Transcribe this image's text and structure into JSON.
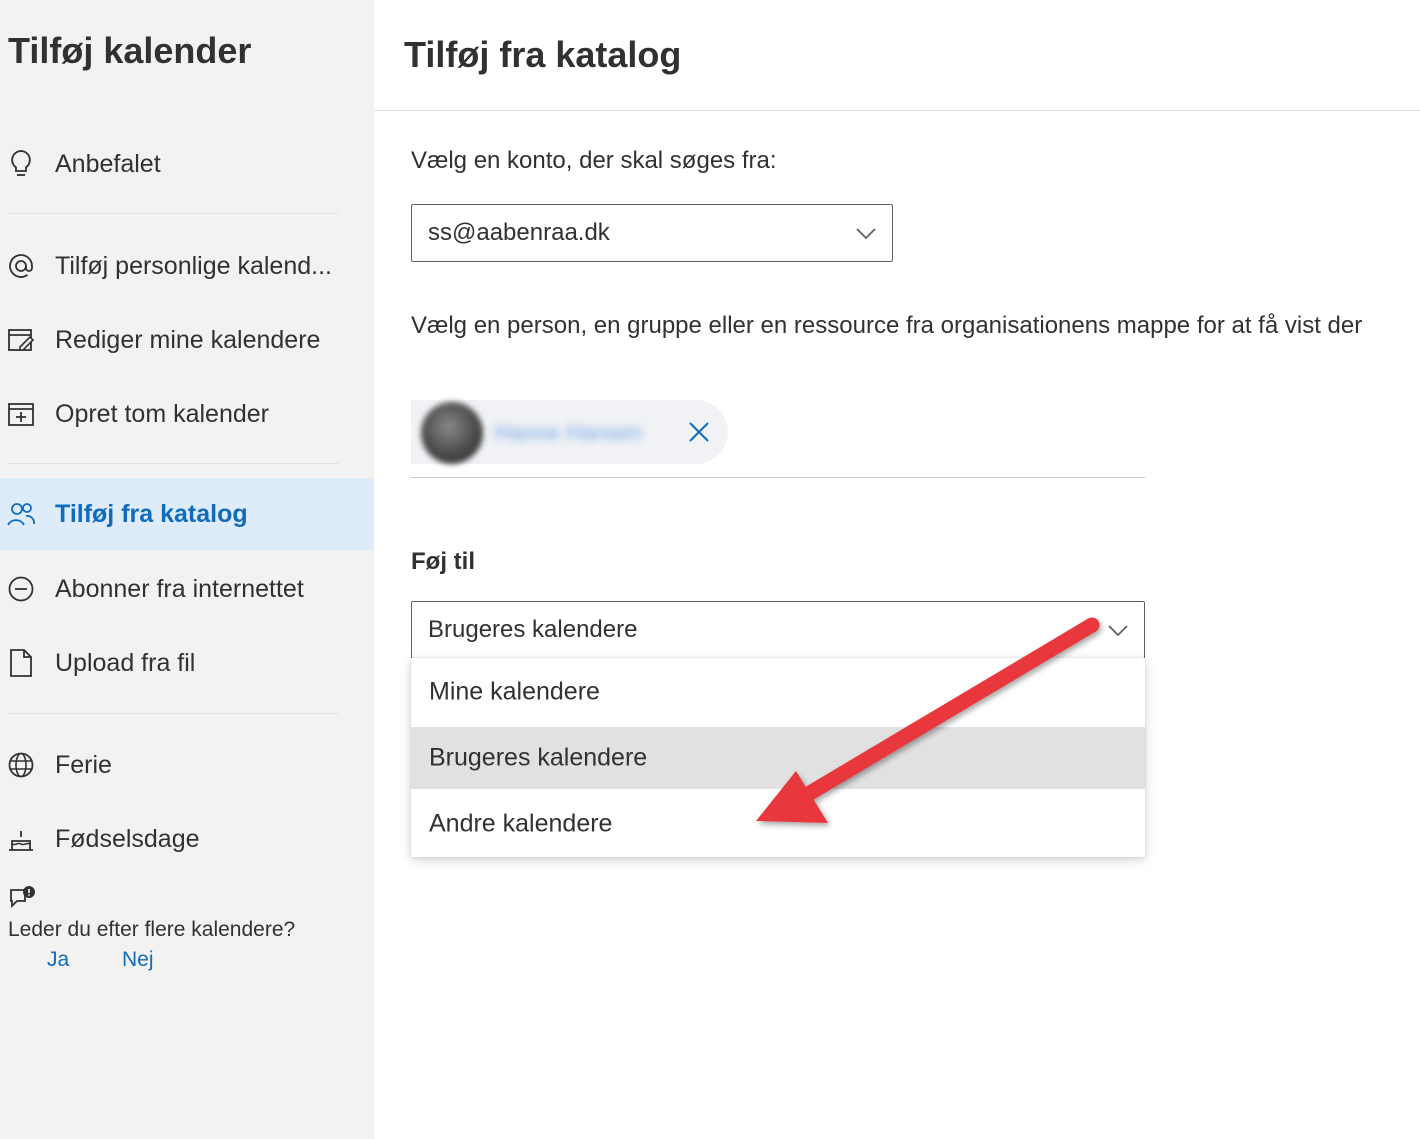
{
  "sidebar": {
    "title": "Tilføj kalender",
    "items": [
      {
        "label": "Anbefalet",
        "icon": "lightbulb-icon"
      },
      {
        "label": "Tilføj personlige kalend...",
        "icon": "at-icon"
      },
      {
        "label": "Rediger mine kalendere",
        "icon": "edit-calendar-icon"
      },
      {
        "label": "Opret tom kalender",
        "icon": "add-calendar-icon"
      },
      {
        "label": "Tilføj fra katalog",
        "icon": "people-icon",
        "selected": true
      },
      {
        "label": "Abonner fra internettet",
        "icon": "subscribe-icon"
      },
      {
        "label": "Upload fra fil",
        "icon": "file-icon"
      },
      {
        "label": "Ferie",
        "icon": "globe-icon"
      },
      {
        "label": "Fødselsdage",
        "icon": "cake-icon"
      }
    ],
    "feedback": {
      "question": "Leder du efter flere kalendere?",
      "yes": "Ja",
      "no": "Nej"
    }
  },
  "main": {
    "title": "Tilføj fra katalog",
    "account_label": "Vælg en konto, der skal søges fra:",
    "account_value": "ss@aabenraa.dk",
    "description": "Vælg en person, en gruppe eller en ressource fra organisationens mappe for at få vist der",
    "add_to_label": "Føj til",
    "add_to_value": "Brugeres kalendere",
    "options": [
      "Mine kalendere",
      "Brugeres kalendere",
      "Andre kalendere"
    ],
    "highlighted_option": "Brugeres kalendere",
    "persona_name": "Hanne Hansen"
  },
  "colors": {
    "accent": "#0f6cbd",
    "sidebar_bg": "#f3f2f1",
    "selected_bg": "#deecf9",
    "annotation_arrow": "#e8383d"
  }
}
